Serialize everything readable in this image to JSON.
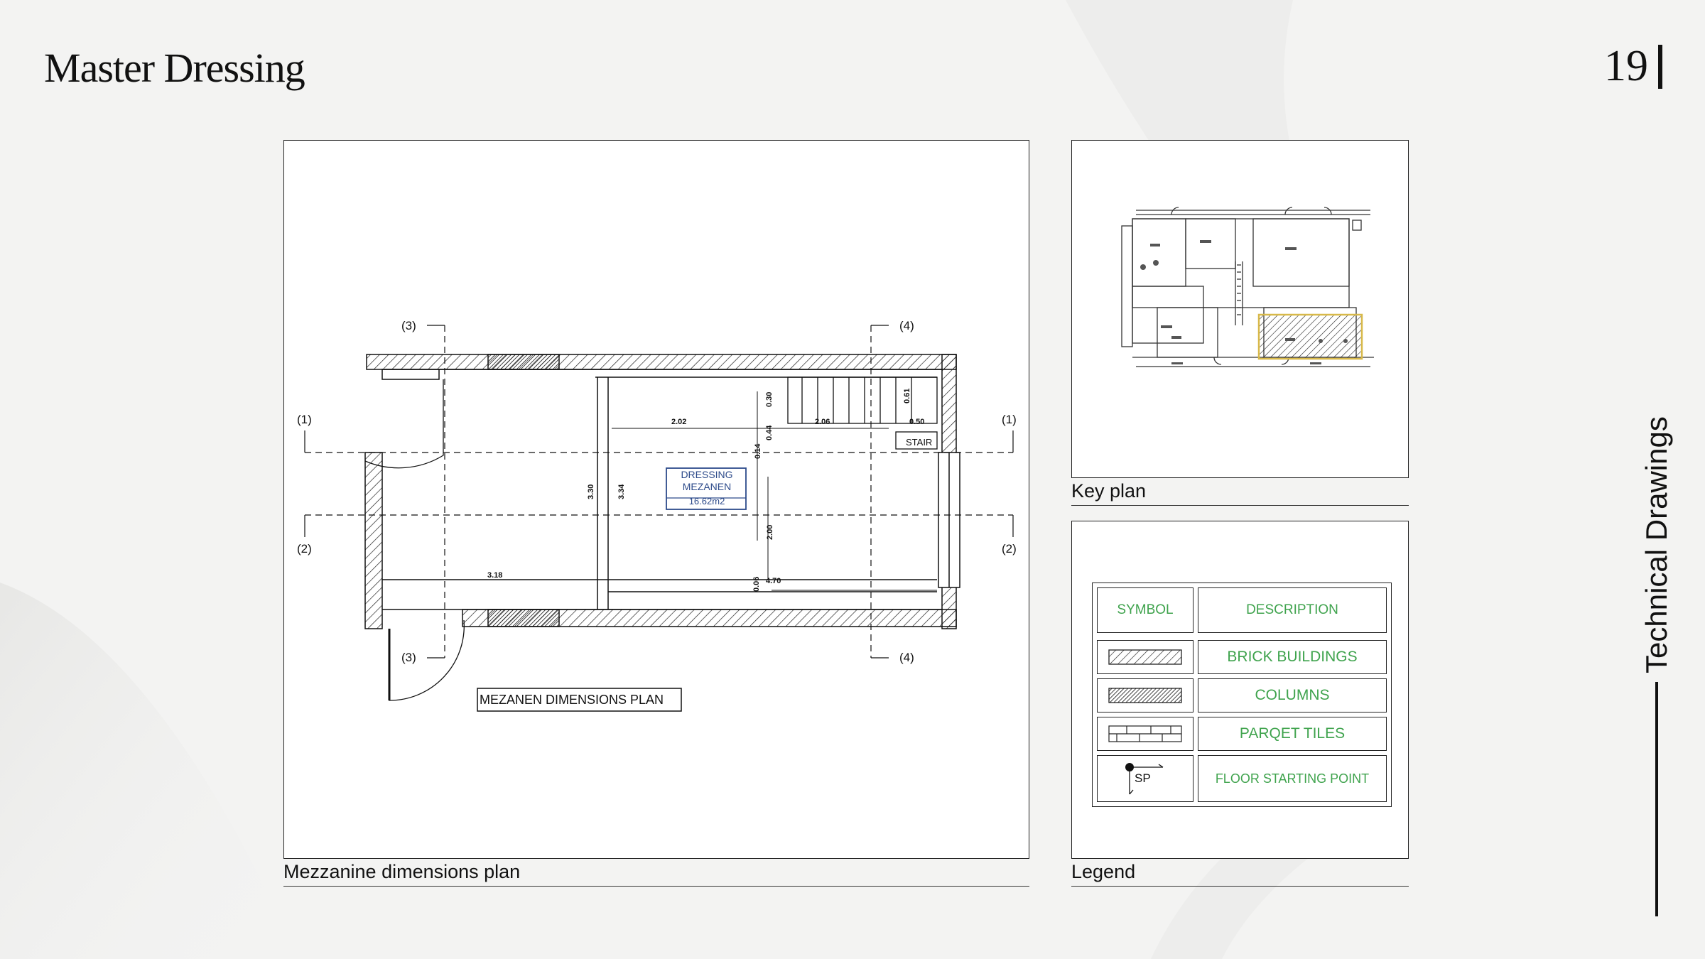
{
  "header": {
    "title": "Master Dressing",
    "page_number": "19"
  },
  "side_label": "Technical Drawings",
  "main_plan": {
    "caption": "Mezzanine dimensions plan",
    "plan_title": "MEZANEN DIMENSIONS PLAN",
    "room": {
      "name_line1": "DRESSING",
      "name_line2": "MEZANEN",
      "area": "16.62m2"
    },
    "stair_label": "STAIR",
    "section_markers": [
      "(1)",
      "(2)",
      "(3)",
      "(4)"
    ],
    "dimensions": {
      "d_202": "2.02",
      "d_206": "2.06",
      "d_050": "0.50",
      "d_061": "0.61",
      "d_030": "0.30",
      "d_044": "0.44",
      "d_014": "0.14",
      "d_330": "3.30",
      "d_334": "3.34",
      "d_200": "2.00",
      "d_318": "3.18",
      "d_006": "0.06",
      "d_470": "4.70"
    }
  },
  "key_plan": {
    "caption": "Key plan"
  },
  "legend": {
    "caption": "Legend",
    "header": {
      "symbol": "SYMBOL",
      "description": "DESCRIPTION"
    },
    "rows": [
      {
        "symbol_icon": "hatch-light-icon",
        "label": "BRICK BUILDINGS"
      },
      {
        "symbol_icon": "hatch-dark-icon",
        "label": "COLUMNS"
      },
      {
        "symbol_icon": "parquet-icon",
        "label": "PARQET TILES"
      },
      {
        "symbol_icon": "floor-start-icon",
        "symbol_text": "SP",
        "label": "FLOOR STARTING POINT"
      }
    ],
    "accent_color": "#3fa34d"
  }
}
